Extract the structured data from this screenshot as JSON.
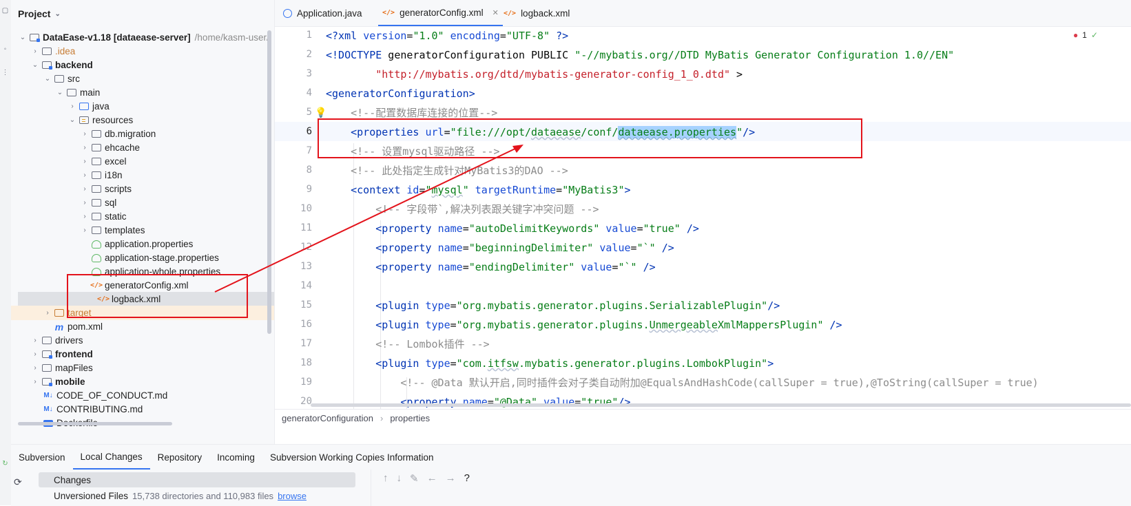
{
  "project": {
    "header_label": "Project",
    "tree": [
      {
        "label": "DataEase-v1.18",
        "suffix": "[dataease-server]",
        "path": "/home/kasm-user/"
      },
      {
        "label": ".idea"
      },
      {
        "label": "backend"
      },
      {
        "label": "src"
      },
      {
        "label": "main"
      },
      {
        "label": "java"
      },
      {
        "label": "resources"
      },
      {
        "label": "db.migration"
      },
      {
        "label": "ehcache"
      },
      {
        "label": "excel"
      },
      {
        "label": "i18n"
      },
      {
        "label": "scripts"
      },
      {
        "label": "sql"
      },
      {
        "label": "static"
      },
      {
        "label": "templates"
      },
      {
        "label": "application.properties"
      },
      {
        "label": "application-stage.properties"
      },
      {
        "label": "application-whole.properties"
      },
      {
        "label": "generatorConfig.xml"
      },
      {
        "label": "logback.xml"
      },
      {
        "label": "target"
      },
      {
        "label": "pom.xml"
      },
      {
        "label": "drivers"
      },
      {
        "label": "frontend"
      },
      {
        "label": "mapFiles"
      },
      {
        "label": "mobile"
      },
      {
        "label": "CODE_OF_CONDUCT.md"
      },
      {
        "label": "CONTRIBUTING.md"
      },
      {
        "label": "Dockerfile"
      }
    ]
  },
  "editor": {
    "tabs": [
      {
        "label": "Application.java"
      },
      {
        "label": "generatorConfig.xml"
      },
      {
        "label": "logback.xml"
      }
    ],
    "error_count": "1",
    "line_numbers": [
      "1",
      "2",
      "3",
      "4",
      "5",
      "6",
      "7",
      "8",
      "9",
      "10",
      "11",
      "12",
      "13",
      "14",
      "15",
      "16",
      "17",
      "18",
      "19",
      "20"
    ],
    "current_line": "6",
    "breadcrumb": [
      "generatorConfiguration",
      "properties"
    ]
  },
  "bottom": {
    "tabs": [
      "Subversion",
      "Local Changes",
      "Repository",
      "Incoming",
      "Subversion Working Copies Information"
    ],
    "active_tab": "Local Changes",
    "changes_label": "Changes",
    "unversioned_label": "Unversioned Files",
    "unversioned_count": "15,738 directories and 110,983 files",
    "browse_link": "browse"
  },
  "colors": {
    "accent": "#3574f0",
    "annotation": "#e3131b",
    "xml_tag": "#0033b3",
    "xml_value": "#067d17",
    "comment": "#8c8c8c"
  }
}
